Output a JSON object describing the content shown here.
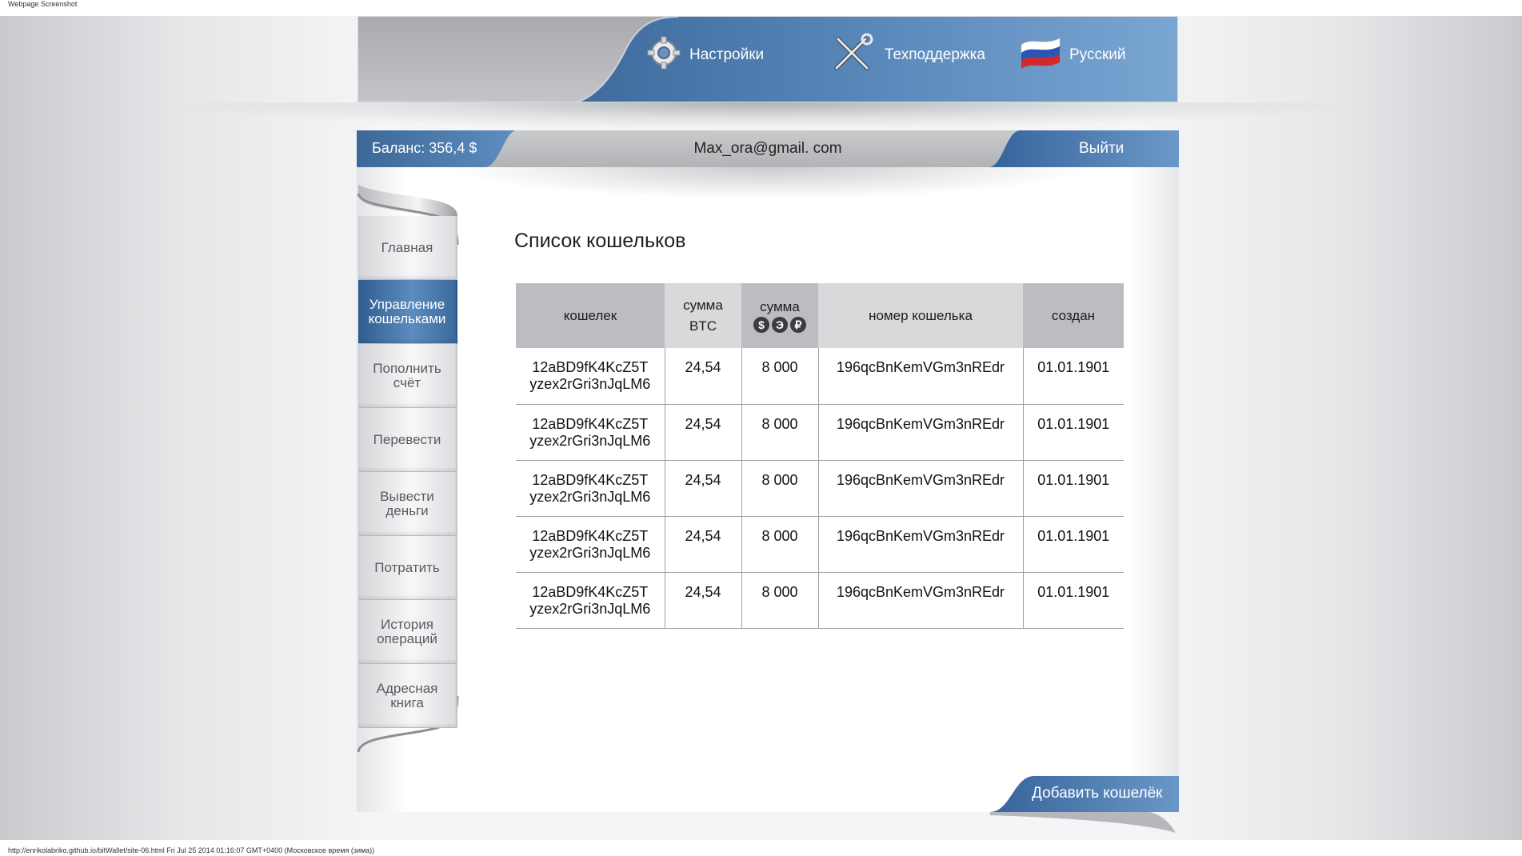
{
  "browser": {
    "caption": "Webpage Screenshot",
    "footer": "http://enrikolabriko.github.io/bitWallet/site-06.html Fri Jul 25 2014 01:16:07 GMT+0400 (Московское время (зима))"
  },
  "header": {
    "settings_label": "Настройки",
    "support_label": "Техподдержка",
    "language_label": "Русский"
  },
  "userbar": {
    "balance": "Баланс: 356,4 $",
    "email": "Max_ora@gmail. com",
    "logout_label": "Выйти"
  },
  "sidebar": {
    "items": [
      {
        "label": "Главная",
        "active": false
      },
      {
        "label": "Управление кошельками",
        "active": true
      },
      {
        "label": "Пополнить счёт",
        "active": false
      },
      {
        "label": "Перевести",
        "active": false
      },
      {
        "label": "Вывести деньги",
        "active": false
      },
      {
        "label": "Потратить",
        "active": false
      },
      {
        "label": "История операций",
        "active": false
      },
      {
        "label": "Адресная книга",
        "active": false
      }
    ]
  },
  "main": {
    "title": "Список кошельков",
    "table": {
      "columns": {
        "wallet": "кошелек",
        "sum_btc": "сумма BTC",
        "sum_fiat": "сумма",
        "currency_icons": [
          "$",
          "Э",
          "₽"
        ],
        "wallet_number": "номер кошелька",
        "created": "создан"
      },
      "rows": [
        {
          "wallet": "12aBD9fK4KcZ5T yzex2rGri3nJqLM6",
          "sum_btc": "24,54",
          "sum_fiat": "8 000",
          "number": "196qcBnKemVGm3nREdr",
          "created": "01.01.1901"
        },
        {
          "wallet": "12aBD9fK4KcZ5T yzex2rGri3nJqLM6",
          "sum_btc": "24,54",
          "sum_fiat": "8 000",
          "number": "196qcBnKemVGm3nREdr",
          "created": "01.01.1901"
        },
        {
          "wallet": "12aBD9fK4KcZ5T yzex2rGri3nJqLM6",
          "sum_btc": "24,54",
          "sum_fiat": "8 000",
          "number": "196qcBnKemVGm3nREdr",
          "created": "01.01.1901"
        },
        {
          "wallet": "12aBD9fK4KcZ5T yzex2rGri3nJqLM6",
          "sum_btc": "24,54",
          "sum_fiat": "8 000",
          "number": "196qcBnKemVGm3nREdr",
          "created": "01.01.1901"
        },
        {
          "wallet": "12aBD9fK4KcZ5T yzex2rGri3nJqLM6",
          "sum_btc": "24,54",
          "sum_fiat": "8 000",
          "number": "196qcBnKemVGm3nREdr",
          "created": "01.01.1901"
        }
      ]
    },
    "add_wallet_label": "Добавить кошелёк"
  },
  "colors": {
    "accent_blue": "#4f7fb3",
    "header_gray": "#b5b6b9",
    "table_header_dark": "#bcbdc0",
    "table_header_light": "#d8d9db"
  },
  "icons": [
    "gear-icon",
    "tools-icon",
    "russian-flag-icon",
    "dollar-icon",
    "euro-icon",
    "ruble-icon"
  ]
}
